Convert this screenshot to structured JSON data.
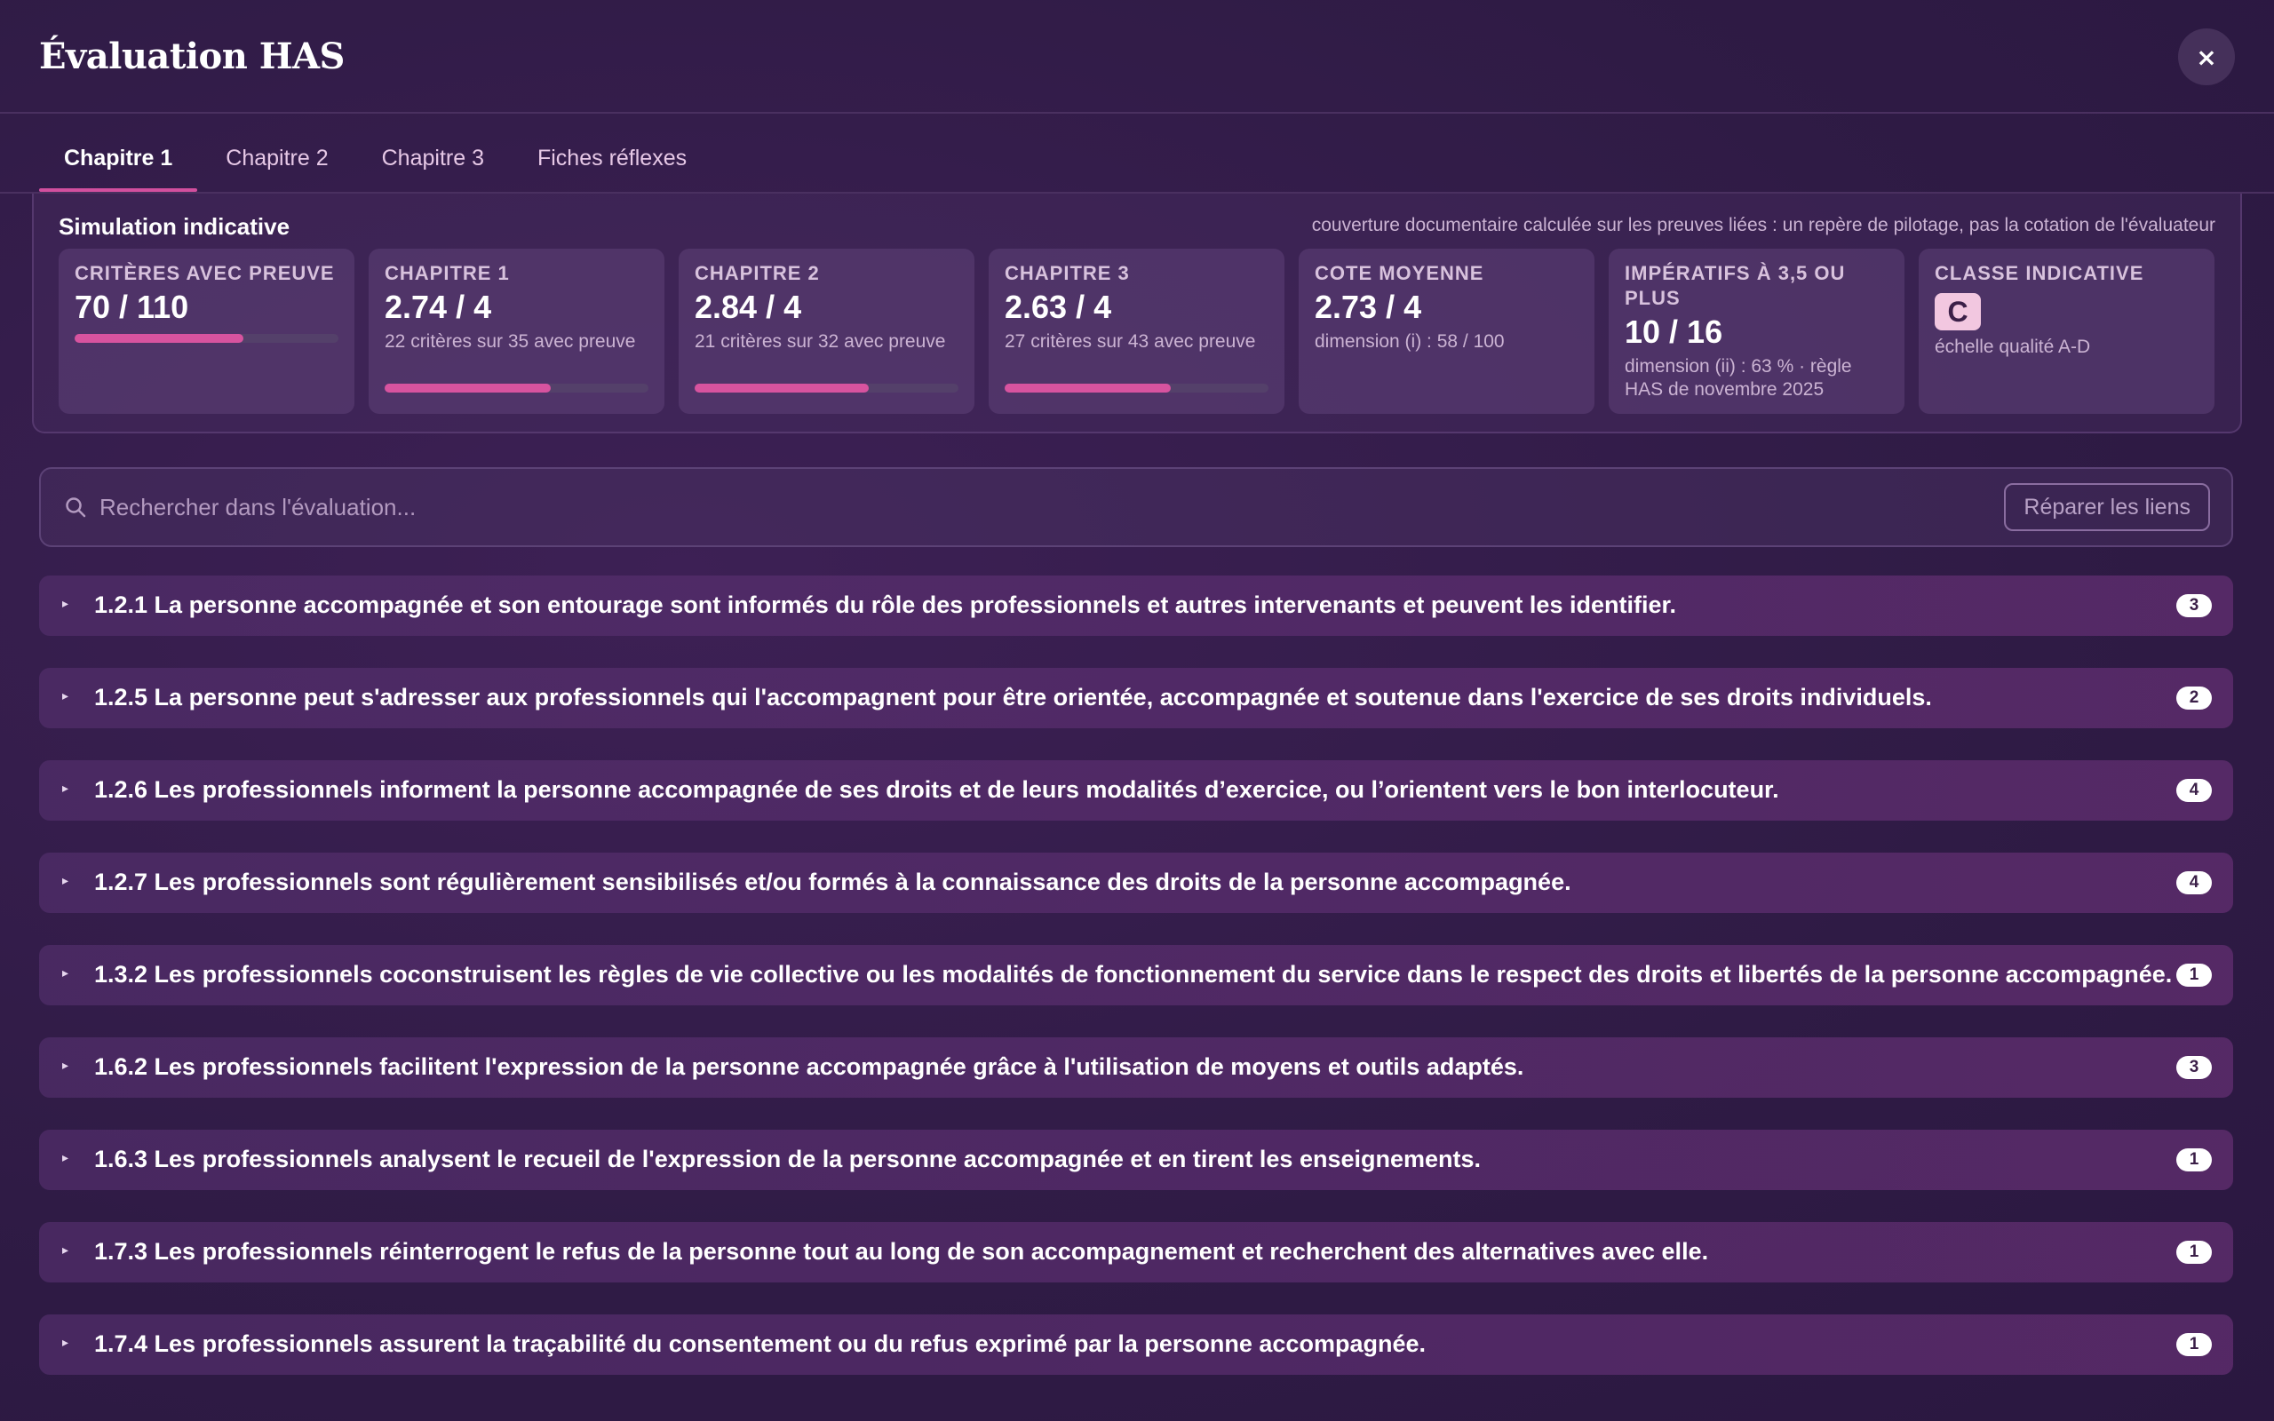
{
  "header": {
    "title": "Évaluation HAS",
    "close_label": "×"
  },
  "tabs": [
    {
      "label": "Chapitre 1",
      "active": true
    },
    {
      "label": "Chapitre 2",
      "active": false
    },
    {
      "label": "Chapitre 3",
      "active": false
    },
    {
      "label": "Fiches réflexes",
      "active": false
    }
  ],
  "simulation": {
    "title": "Simulation indicative",
    "note": "couverture documentaire calculée sur les preuves liées : un repère de pilotage, pas la cotation de l'évaluateur",
    "cards": [
      {
        "label": "Critères avec preuve",
        "value": "70 / 110",
        "sub": "",
        "progress": 0.64
      },
      {
        "label": "Chapitre 1",
        "value": "2.74 / 4",
        "sub": "22 critères sur 35 avec preuve",
        "progress": 0.63
      },
      {
        "label": "Chapitre 2",
        "value": "2.84 / 4",
        "sub": "21 critères sur 32 avec preuve",
        "progress": 0.66
      },
      {
        "label": "Chapitre 3",
        "value": "2.63 / 4",
        "sub": "27 critères sur 43 avec preuve",
        "progress": 0.63
      },
      {
        "label": "Cote moyenne",
        "value": "2.73 / 4",
        "sub": "dimension (i) : 58 / 100"
      },
      {
        "label": "Impératifs à 3,5 ou plus",
        "value": "10 / 16",
        "sub": "dimension (ii) : 63 % · règle HAS de novembre 2025"
      },
      {
        "label": "Classe indicative",
        "grade": "C",
        "sub": "échelle qualité A-D"
      }
    ]
  },
  "search": {
    "placeholder": "Rechercher dans l'évaluation...",
    "repair_label": "Réparer les liens"
  },
  "criteria": [
    {
      "caret": "▸",
      "text": "1.2.1 La personne accompagnée et son entourage sont informés du rôle des professionnels et autres intervenants et peuvent les identifier.",
      "count": "3"
    },
    {
      "caret": "▸",
      "text": "1.2.5 La personne peut s'adresser aux professionnels qui l'accompagnent pour être orientée, accompagnée et soutenue dans l'exercice de ses droits individuels.",
      "count": "2"
    },
    {
      "caret": "▸",
      "text": "1.2.6 Les professionnels informent la personne accompagnée de ses droits et de leurs modalités d’exercice, ou l’orientent vers le bon interlocuteur.",
      "count": "4"
    },
    {
      "caret": "▸",
      "text": "1.2.7 Les professionnels sont régulièrement sensibilisés et/ou formés à la connaissance des droits de la personne accompagnée.",
      "count": "4"
    },
    {
      "caret": "▸",
      "text": "1.3.2 Les professionnels coconstruisent les règles de vie collective ou les modalités de fonctionnement du service dans le respect des droits et libertés de la personne accompagnée.",
      "count": "1"
    },
    {
      "caret": "▸",
      "text": "1.6.2 Les professionnels facilitent l'expression de la personne accompagnée grâce à l'utilisation de moyens et outils adaptés.",
      "count": "3"
    },
    {
      "caret": "▸",
      "text": "1.6.3 Les professionnels analysent le recueil de l'expression de la personne accompagnée et en tirent les enseignements.",
      "count": "1"
    },
    {
      "caret": "▸",
      "text": "1.7.3 Les professionnels réinterrogent le refus de la personne tout au long de son accompagnement et recherchent des alternatives avec elle.",
      "count": "1"
    },
    {
      "caret": "▸",
      "text": "1.7.4 Les professionnels assurent la traçabilité du consentement ou du refus exprimé par la personne accompagnée.",
      "count": "1"
    }
  ],
  "colors": {
    "accent": "#d7539f",
    "background": "#2f1b45",
    "badge": "#f2c7e0"
  }
}
